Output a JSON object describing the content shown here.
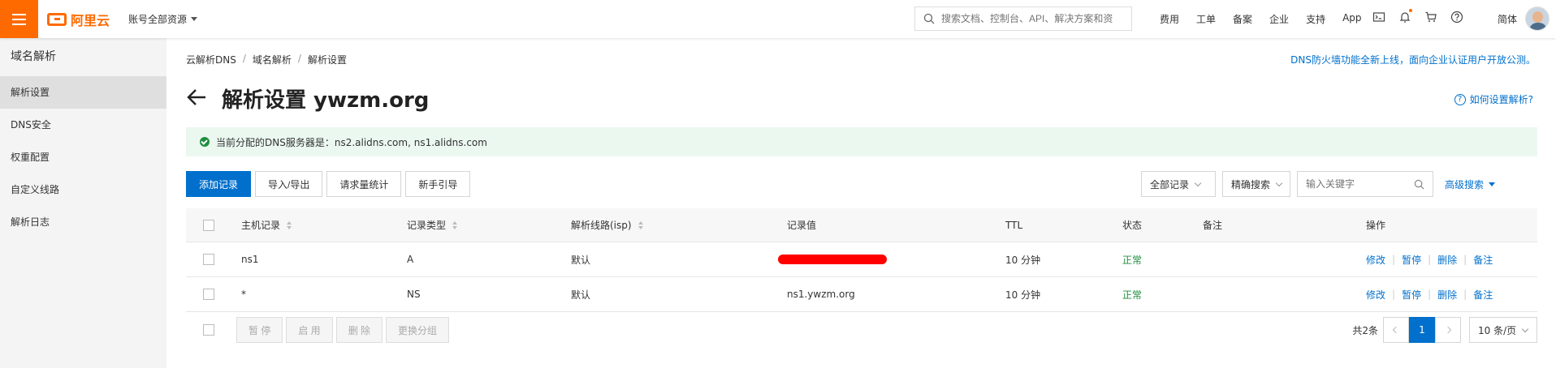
{
  "topbar": {
    "logo_text": "阿里云",
    "account_label": "账号全部资源",
    "search_placeholder": "搜索文档、控制台、API、解决方案和资",
    "links": [
      "费用",
      "工单",
      "备案",
      "企业",
      "支持",
      "App"
    ],
    "lang": "简体"
  },
  "sidebar": {
    "title": "域名解析",
    "items": [
      "解析设置",
      "DNS安全",
      "权重配置",
      "自定义线路",
      "解析日志"
    ]
  },
  "breadcrumb": [
    "云解析DNS",
    "域名解析",
    "解析设置"
  ],
  "notice": "DNS防火墙功能全新上线，面向企业认证用户开放公测。",
  "page": {
    "title": "解析设置 ywzm.org",
    "help": "如何设置解析?"
  },
  "banner": "当前分配的DNS服务器是：ns2.alidns.com, ns1.alidns.com",
  "toolbar": {
    "add": "添加记录",
    "import_export": "导入/导出",
    "stats": "请求量统计",
    "guide": "新手引导",
    "filter_all": "全部记录",
    "filter_exact": "精确搜索",
    "keyword_placeholder": "输入关键字",
    "advanced": "高级搜索"
  },
  "table": {
    "headers": [
      "主机记录",
      "记录类型",
      "解析线路(isp)",
      "记录值",
      "TTL",
      "状态",
      "备注",
      "操作"
    ],
    "rows": [
      {
        "host": "ns1",
        "type": "A",
        "line": "默认",
        "value": "",
        "ttl": "10 分钟",
        "status": "正常",
        "remark": ""
      },
      {
        "host": "*",
        "type": "NS",
        "line": "默认",
        "value": "ns1.ywzm.org",
        "ttl": "10 分钟",
        "status": "正常",
        "remark": ""
      }
    ],
    "actions": [
      "修改",
      "暂停",
      "删除",
      "备注"
    ]
  },
  "footer": {
    "batch": [
      "暂 停",
      "启 用",
      "删 除",
      "更换分组"
    ],
    "total": "共2条",
    "page": "1",
    "page_size": "10 条/页"
  },
  "colors": {
    "brand": "#ff6a00",
    "primary": "#0070cc",
    "success": "#1e8e3e"
  }
}
